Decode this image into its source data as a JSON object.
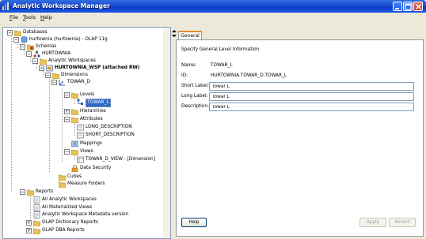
{
  "window": {
    "title": "Analytic Workspace Manager"
  },
  "menu": [
    {
      "first": "F",
      "rest": "ile"
    },
    {
      "first": "T",
      "rest": "ools"
    },
    {
      "first": "H",
      "rest": "elp"
    }
  ],
  "tree": {
    "databases": "Databases",
    "connection": "hurtownia (hurtownia) - OLAP 11g",
    "schemas": "Schemas",
    "schema": "HURTOWNIA",
    "analytic_workspaces": "Analytic Workspaces",
    "workspace": "HURTOWNIA_WSP (attached RW)",
    "dimensions": "Dimensions",
    "dimension": "TOWAR_D",
    "levels": "Levels",
    "level": "TOWAR_L",
    "hierarchies": "Hierarchies",
    "attributes": "Attributes",
    "attr_long": "LONG_DESCRIPTION",
    "attr_short": "SHORT_DESCRIPTION",
    "mappings": "Mappings",
    "views": "Views",
    "view": "TOWAR_D_VIEW - [Dimension]",
    "data_security": "Data Security",
    "cubes": "Cubes",
    "measure_folders": "Measure Folders",
    "reports": "Reports",
    "report_all_aw": "All Analytic Workspaces",
    "report_all_mv": "All Materialized Views",
    "report_aw_meta": "Analytic Workspace Metadata version",
    "report_olap_dict": "OLAP Dictionary Reports",
    "report_olap_dba": "OLAP DBA Reports"
  },
  "panel": {
    "tab": "General",
    "section_title": "Specify General Level Information",
    "name_label": "Name:",
    "name_value": "TOWAR_L",
    "id_label": "ID:",
    "id_value": "HURTOWNIA.TOWAR_D.TOWAR_L",
    "short_label_label": "Short Label:",
    "short_label_value": "Towar L",
    "long_label_label": "Long Label:",
    "long_label_value": "Towar L",
    "description_label": "Description:",
    "description_value": "Towar L",
    "help_button": "Help",
    "apply_button": "Apply",
    "revert_button": "Revert"
  }
}
